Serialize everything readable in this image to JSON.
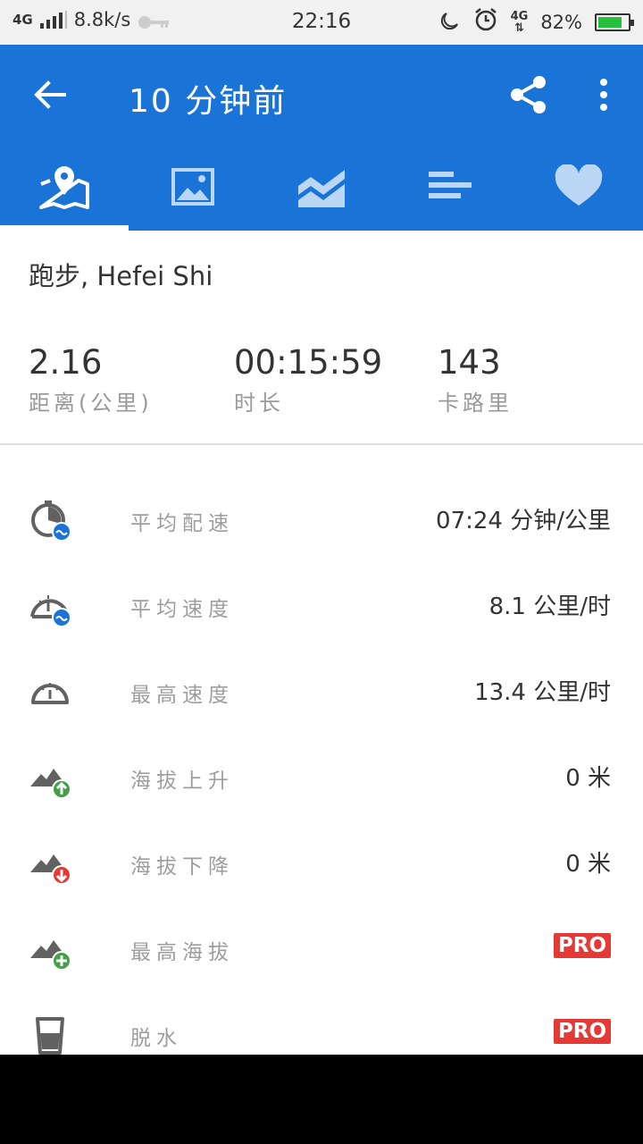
{
  "status_bar": {
    "network": "4G",
    "speed": "8.8k/s",
    "time": "22:16",
    "net_right": "4G",
    "battery": "82%",
    "battery_level": 0.82
  },
  "app_bar": {
    "title": "10 分钟前"
  },
  "tabs": [
    {
      "name": "map-tab",
      "icon": "map-pin-icon",
      "active": true
    },
    {
      "name": "photo-tab",
      "icon": "image-icon",
      "active": false
    },
    {
      "name": "chart-tab",
      "icon": "area-chart-icon",
      "active": false
    },
    {
      "name": "splits-tab",
      "icon": "bars-icon",
      "active": false
    },
    {
      "name": "heart-tab",
      "icon": "heart-icon",
      "active": false
    }
  ],
  "activity": {
    "title": "跑步, Hefei Shi"
  },
  "summary": {
    "distance_value": "2.16",
    "distance_label": "距离(公里)",
    "duration_value": "00:15:59",
    "duration_label": "时长",
    "calories_value": "143",
    "calories_label": "卡路里"
  },
  "metrics": [
    {
      "label": "平均配速",
      "value": "07:24 分钟/公里",
      "icon": "stopwatch-avg-icon"
    },
    {
      "label": "平均速度",
      "value": "8.1 公里/时",
      "icon": "speedometer-avg-icon"
    },
    {
      "label": "最高速度",
      "value": "13.4 公里/时",
      "icon": "speedometer-icon"
    },
    {
      "label": "海拔上升",
      "value": "0 米",
      "icon": "elevation-up-icon"
    },
    {
      "label": "海拔下降",
      "value": "0 米",
      "icon": "elevation-down-icon"
    },
    {
      "label": "最高海拔",
      "value": "PRO",
      "icon": "elevation-max-icon"
    },
    {
      "label": "脱水",
      "value": "PRO",
      "icon": "glass-icon"
    }
  ],
  "colors": {
    "app_bar": "#1a73d6",
    "pro_badge": "#e53935",
    "up_arrow": "#43a047",
    "down_arrow": "#e53935",
    "avg_badge": "#1a73d6"
  }
}
